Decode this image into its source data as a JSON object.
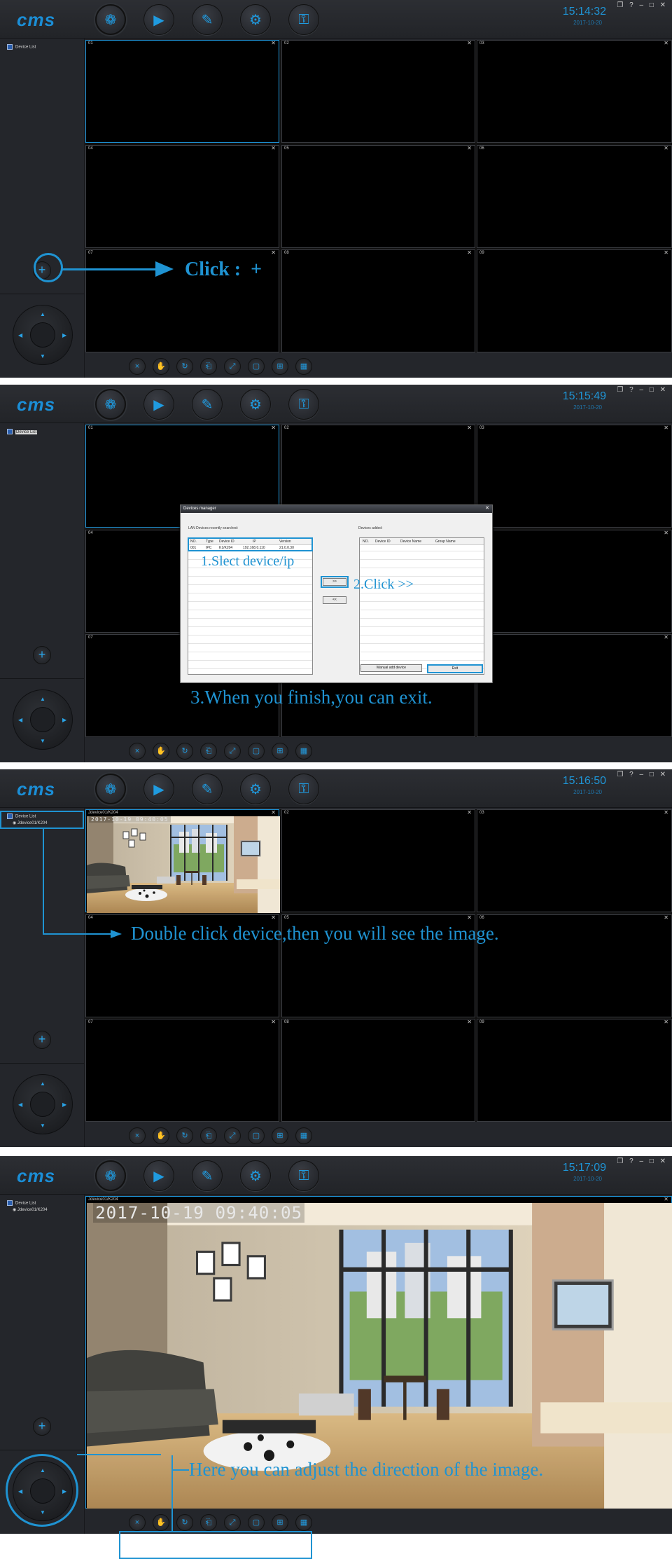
{
  "app": {
    "logo": "cms",
    "toolbar_icons": [
      "live-view-icon",
      "playback-icon",
      "config-icon",
      "settings-gear-icon",
      "lock-icon"
    ],
    "window_controls": "❐ ? – □ ✕",
    "device_list_label": "Device List",
    "device_name": "Jdevice01/K204",
    "bottom_icons": [
      "mute-icon",
      "hand-icon",
      "rotate-icon",
      "snapshot-icon",
      "fullscreen-icon",
      "single-layout-icon",
      "quad-layout-icon",
      "multi-layout-icon"
    ],
    "accent_color": "#1f93d2"
  },
  "panels": [
    {
      "clock": "15:14:32",
      "date": "2017-10-20"
    },
    {
      "clock": "15:15:49",
      "date": "2017-10-20"
    },
    {
      "clock": "15:16:50",
      "date": "2017-10-20"
    },
    {
      "clock": "15:17:09",
      "date": "2017-10-20"
    }
  ],
  "cells": [
    "01",
    "02",
    "03",
    "04",
    "05",
    "06",
    "07",
    "08",
    "09"
  ],
  "annotations": {
    "click_plus": "Click :  +",
    "step1": "1.Slect device/ip",
    "step2": "2.Click >>",
    "step3": "3.When you finish,you can exit.",
    "double_click": "Double click device,then you will see the image.",
    "adjust": "Here you can adjust the direction of the image."
  },
  "devices_manager": {
    "title": "Devices manager",
    "left_label": "LAN Devices recently searched:",
    "left_columns": [
      "NO.",
      "Type",
      "Device ID",
      "IP",
      "Version"
    ],
    "left_row": [
      "001",
      "IPC",
      "K1/K204",
      "192.168.0.110",
      "21.0.0.30"
    ],
    "right_label": "Devices added:",
    "right_columns": [
      "NO.",
      "Device ID",
      "Device Name",
      "Group Name"
    ],
    "add_button": ">>",
    "remove_button": "<<",
    "manual_add_button": "Manual add device",
    "exit_button": "Exit"
  },
  "video": {
    "osd_timestamp": "2017-10-19  09:40:05",
    "title_label": "Jdevice01/K204"
  }
}
